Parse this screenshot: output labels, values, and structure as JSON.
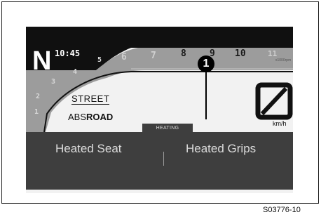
{
  "dashboard": {
    "gear": "N",
    "time": "10:45",
    "tach_upper": [
      "6",
      "7",
      "8",
      "9",
      "10",
      "11"
    ],
    "tach_unit": "x1000rpm",
    "tach_lower": [
      "1",
      "2",
      "3",
      "4",
      "5"
    ],
    "ride_mode": "STREET",
    "abs_prefix": "ABS",
    "abs_mode": "ROAD",
    "speed_unit": "km/h",
    "heating_tab": "HEATING",
    "heated_seat_label": "Heated Seat",
    "heated_grips_label": "Heated Grips"
  },
  "callout_number": "1",
  "figure_code": "S03776-10"
}
